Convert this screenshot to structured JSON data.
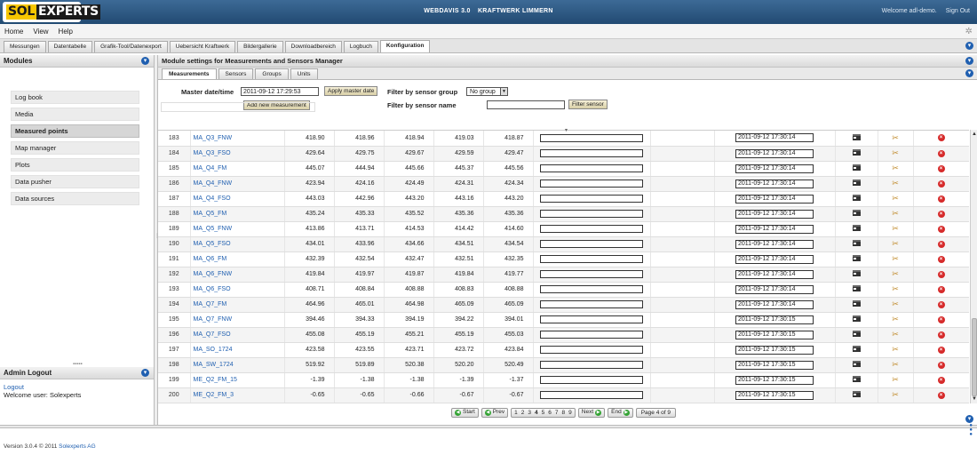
{
  "topbar": {
    "logo_left": "SOL",
    "logo_right": "EXPERTS",
    "app": "WEBDAVIS 3.0",
    "plant": "KRAFTWERK LIMMERN",
    "welcome": "Welcome adl-demo.",
    "signout": "Sign Out"
  },
  "menu": [
    "Home",
    "View",
    "Help"
  ],
  "main_tabs": [
    "Messungen",
    "Datentabelle",
    "Grafik-Tool/Datenexport",
    "Uebersicht Kraftwerk",
    "Bildergallerie",
    "Downloadbereich",
    "Logbuch",
    "Konfiguration"
  ],
  "modules": {
    "title": "Modules",
    "items": [
      "Log book",
      "Media",
      "Measured points",
      "Map manager",
      "Plots",
      "Data pusher",
      "Data sources"
    ]
  },
  "admin": {
    "title": "Admin Logout",
    "logout": "Logout",
    "user": "Welcome user: Solexperts"
  },
  "settings": {
    "title": "Module settings for Measurements and Sensors Manager",
    "tabs": [
      "Measurements",
      "Sensors",
      "Groups",
      "Units"
    ],
    "master_label": "Master date/time",
    "master_value": "2011-09-12 17:29:53",
    "apply_btn": "Apply master date",
    "add_btn": "Add new measurement",
    "group_label": "Filter by sensor group",
    "group_value": "No group",
    "name_label": "Filter by sensor name",
    "name_value": "",
    "filter_btn": "Filter sensor"
  },
  "rows": [
    [
      "183",
      "MA_Q3_FNW",
      "418.90",
      "418.96",
      "418.94",
      "419.03",
      "418.87",
      "2011-09-12 17:30:14"
    ],
    [
      "184",
      "MA_Q3_FSO",
      "429.64",
      "429.75",
      "429.67",
      "429.59",
      "429.47",
      "2011-09-12 17:30:14"
    ],
    [
      "185",
      "MA_Q4_FM",
      "445.07",
      "444.94",
      "445.66",
      "445.37",
      "445.56",
      "2011-09-12 17:30:14"
    ],
    [
      "186",
      "MA_Q4_FNW",
      "423.94",
      "424.16",
      "424.49",
      "424.31",
      "424.34",
      "2011-09-12 17:30:14"
    ],
    [
      "187",
      "MA_Q4_FSO",
      "443.03",
      "442.96",
      "443.20",
      "443.16",
      "443.20",
      "2011-09-12 17:30:14"
    ],
    [
      "188",
      "MA_Q5_FM",
      "435.24",
      "435.33",
      "435.52",
      "435.36",
      "435.36",
      "2011-09-12 17:30:14"
    ],
    [
      "189",
      "MA_Q5_FNW",
      "413.86",
      "413.71",
      "414.53",
      "414.42",
      "414.60",
      "2011-09-12 17:30:14"
    ],
    [
      "190",
      "MA_Q5_FSO",
      "434.01",
      "433.96",
      "434.66",
      "434.51",
      "434.54",
      "2011-09-12 17:30:14"
    ],
    [
      "191",
      "MA_Q6_FM",
      "432.39",
      "432.54",
      "432.47",
      "432.51",
      "432.35",
      "2011-09-12 17:30:14"
    ],
    [
      "192",
      "MA_Q6_FNW",
      "419.84",
      "419.97",
      "419.87",
      "419.84",
      "419.77",
      "2011-09-12 17:30:14"
    ],
    [
      "193",
      "MA_Q6_FSO",
      "408.71",
      "408.84",
      "408.88",
      "408.83",
      "408.88",
      "2011-09-12 17:30:14"
    ],
    [
      "194",
      "MA_Q7_FM",
      "464.96",
      "465.01",
      "464.98",
      "465.09",
      "465.09",
      "2011-09-12 17:30:14"
    ],
    [
      "195",
      "MA_Q7_FNW",
      "394.46",
      "394.33",
      "394.19",
      "394.22",
      "394.01",
      "2011-09-12 17:30:15"
    ],
    [
      "196",
      "MA_Q7_FSO",
      "455.08",
      "455.19",
      "455.21",
      "455.19",
      "455.03",
      "2011-09-12 17:30:15"
    ],
    [
      "197",
      "MA_SO_1724",
      "423.58",
      "423.55",
      "423.71",
      "423.72",
      "423.84",
      "2011-09-12 17:30:15"
    ],
    [
      "198",
      "MA_SW_1724",
      "519.92",
      "519.89",
      "520.38",
      "520.20",
      "520.49",
      "2011-09-12 17:30:15"
    ],
    [
      "199",
      "ME_Q2_FM_15",
      "-1.39",
      "-1.38",
      "-1.38",
      "-1.39",
      "-1.37",
      "2011-09-12 17:30:15"
    ],
    [
      "200",
      "ME_Q2_FM_3",
      "-0.65",
      "-0.65",
      "-0.66",
      "-0.67",
      "-0.67",
      "2011-09-12 17:30:15"
    ]
  ],
  "pager": {
    "start": "Start",
    "prev": "Prev",
    "pages": [
      "1",
      "2",
      "3",
      "4",
      "5",
      "6",
      "7",
      "8",
      "9"
    ],
    "current_page": "4",
    "next": "Next",
    "end": "End",
    "info": "Page 4 of 9"
  },
  "footer": {
    "version": "Version 3.0.4 © 2011",
    "company": "Solexperts AG"
  },
  "colors": {
    "topbar": "#2b5680",
    "link": "#1f5fb0",
    "delete": "#d62a2a",
    "pager_dot": "#35a335"
  }
}
